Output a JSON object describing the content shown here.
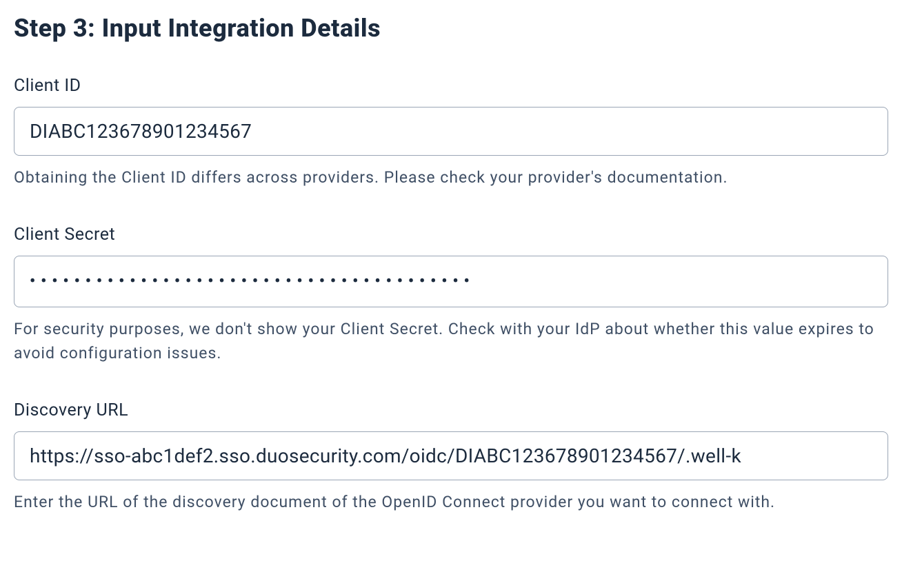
{
  "step": {
    "title": "Step 3: Input Integration Details"
  },
  "fields": {
    "client_id": {
      "label": "Client ID",
      "value": "DIABC123678901234567",
      "help": "Obtaining the Client ID differs across providers. Please check your provider's documentation."
    },
    "client_secret": {
      "label": "Client Secret",
      "value": "••••••••••••••••••••••••••••••••••••••••",
      "help": "For security purposes, we don't show your Client Secret. Check with your IdP about whether this value expires to avoid configuration issues."
    },
    "discovery_url": {
      "label": "Discovery URL",
      "value": "https://sso-abc1def2.sso.duosecurity.com/oidc/DIABC123678901234567/.well-k",
      "help": "Enter the URL of the discovery document of the OpenID Connect provider you want to connect with."
    }
  }
}
